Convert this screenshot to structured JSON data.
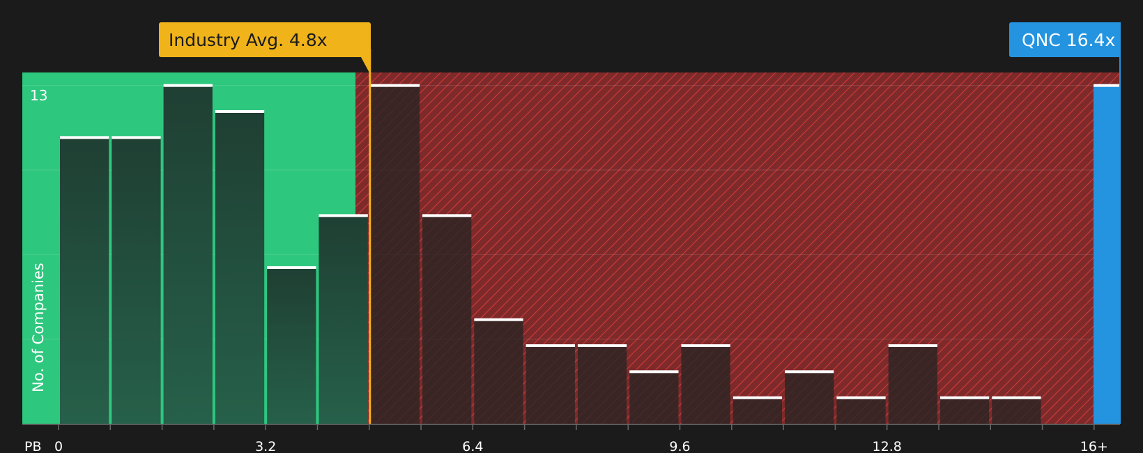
{
  "chart_data": {
    "type": "bar",
    "ylabel": "No. of Companies",
    "x_axis_label": "PB",
    "x_tick_labels": [
      "0",
      "3.2",
      "6.4",
      "9.6",
      "12.8",
      "16+"
    ],
    "x_tick_values": [
      0,
      3.2,
      6.4,
      9.6,
      12.8,
      16
    ],
    "xlim": [
      -0.56,
      16.4
    ],
    "ylim": [
      0,
      13.5
    ],
    "y_tick_label": "13",
    "y_tick_value": 13,
    "bin_width": 0.8,
    "bins": [
      {
        "start": 0.0,
        "count": 11
      },
      {
        "start": 0.8,
        "count": 11
      },
      {
        "start": 1.6,
        "count": 13
      },
      {
        "start": 2.4,
        "count": 12
      },
      {
        "start": 3.2,
        "count": 6
      },
      {
        "start": 4.0,
        "count": 8
      },
      {
        "start": 4.8,
        "count": 13
      },
      {
        "start": 5.6,
        "count": 8
      },
      {
        "start": 6.4,
        "count": 4
      },
      {
        "start": 7.2,
        "count": 3
      },
      {
        "start": 8.0,
        "count": 3
      },
      {
        "start": 8.8,
        "count": 2
      },
      {
        "start": 9.6,
        "count": 3
      },
      {
        "start": 10.4,
        "count": 1
      },
      {
        "start": 11.2,
        "count": 2
      },
      {
        "start": 12.0,
        "count": 1
      },
      {
        "start": 12.8,
        "count": 3
      },
      {
        "start": 13.6,
        "count": 1
      },
      {
        "start": 14.4,
        "count": 1
      }
    ],
    "industry_avg": {
      "label": "Industry Avg. 4.8x",
      "value": 4.8
    },
    "company": {
      "label": "QNC 16.4x",
      "value": 16.4,
      "count": 13
    },
    "fair_zone_end": 4.59,
    "colors": {
      "background": "#1b1b1b",
      "fair_zone": "#2ec77e",
      "overvalued_zone": "#7e2a2a",
      "hatch": "#d23a3a",
      "bar_in_fair": "#23473a",
      "bar_in_over": "#2b2424",
      "bar_cap": "#ffffff",
      "industry_line": "#f0b31a",
      "company": "#2494e0"
    }
  }
}
